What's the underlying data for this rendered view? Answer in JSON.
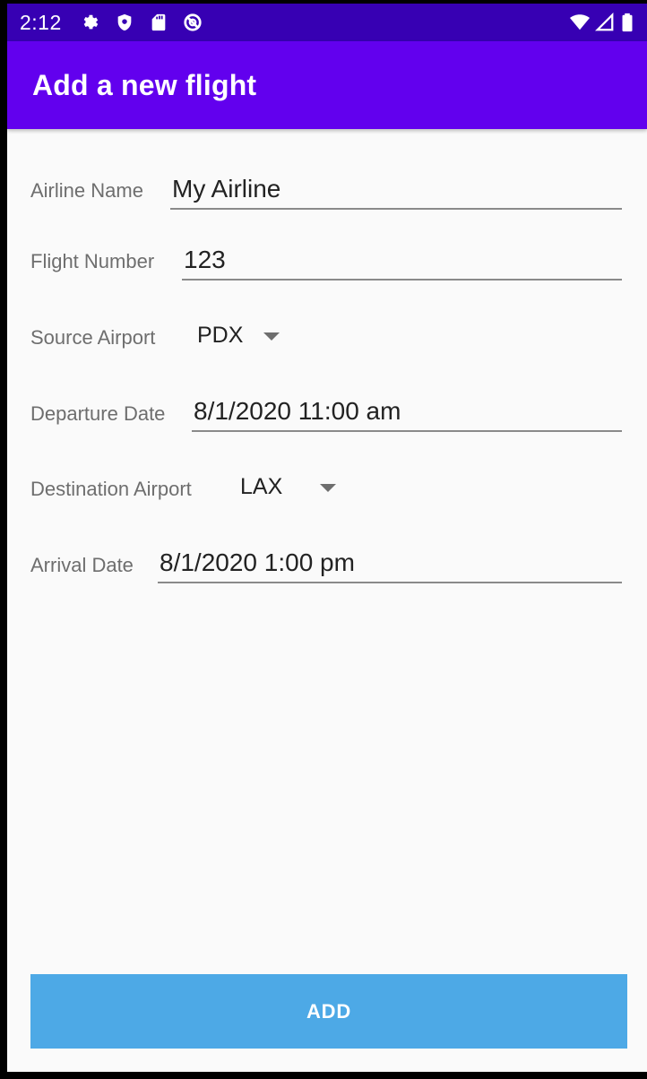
{
  "status_bar": {
    "time": "2:12",
    "left_icons": [
      "settings-icon",
      "shield-icon",
      "sd-card-icon",
      "no-disturb-icon"
    ],
    "right_icons": [
      "wifi-icon",
      "signal-icon",
      "battery-icon"
    ]
  },
  "app_bar": {
    "title": "Add a new flight"
  },
  "form": {
    "airline_name": {
      "label": "Airline Name",
      "value": "My Airline"
    },
    "flight_number": {
      "label": "Flight Number",
      "value": "123"
    },
    "source_airport": {
      "label": "Source Airport",
      "value": "PDX"
    },
    "departure_date": {
      "label": "Departure Date",
      "value": "8/1/2020 11:00 am"
    },
    "destination_airport": {
      "label": "Destination Airport",
      "value": "LAX"
    },
    "arrival_date": {
      "label": "Arrival Date",
      "value": "8/1/2020 1:00 pm"
    }
  },
  "add_button": {
    "label": "ADD"
  },
  "colors": {
    "status_bar": "#3700b3",
    "app_bar": "#6200ee",
    "button": "#4da9e6",
    "background": "#fafafa"
  }
}
